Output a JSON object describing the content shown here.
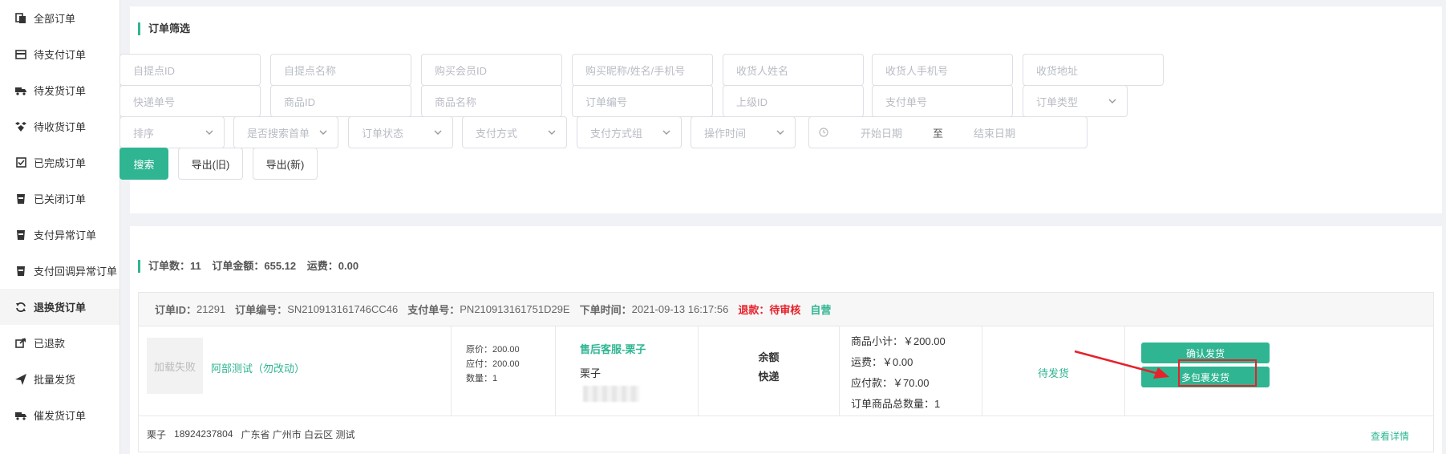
{
  "sidebar": {
    "items": [
      {
        "label": "全部订单",
        "icon": "copy-icon"
      },
      {
        "label": "待支付订单",
        "icon": "card-icon"
      },
      {
        "label": "待发货订单",
        "icon": "truck-icon"
      },
      {
        "label": "待收货订单",
        "icon": "boxes-icon"
      },
      {
        "label": "已完成订单",
        "icon": "check-square-icon"
      },
      {
        "label": "已关闭订单",
        "icon": "cup-icon"
      },
      {
        "label": "支付异常订单",
        "icon": "cup-icon"
      },
      {
        "label": "支付回调异常订单",
        "icon": "cup-icon"
      },
      {
        "label": "退换货订单",
        "icon": "refresh-icon",
        "active": true
      },
      {
        "label": "已退款",
        "icon": "share-icon"
      },
      {
        "label": "批量发货",
        "icon": "send-icon"
      },
      {
        "label": "催发货订单",
        "icon": "truck-icon"
      }
    ]
  },
  "filter": {
    "title": "订单筛选",
    "row1": [
      "自提点ID",
      "自提点名称",
      "购买会员ID",
      "购买昵称/姓名/手机号",
      "收货人姓名",
      "收货人手机号",
      "收货地址"
    ],
    "row2": [
      "快递单号",
      "商品ID",
      "商品名称",
      "订单编号",
      "上级ID",
      "支付单号"
    ],
    "order_type": "订单类型",
    "row3": [
      "排序",
      "是否搜索首单",
      "订单状态",
      "支付方式",
      "支付方式组",
      "操作时间"
    ],
    "date_start": "开始日期",
    "date_sep": "至",
    "date_end": "结束日期",
    "search_btn": "搜索",
    "export_old": "导出(旧)",
    "export_new": "导出(新)"
  },
  "summary": {
    "count": "订单数：11",
    "amount": "订单金额：655.12",
    "freight": "运费：0.00"
  },
  "order": {
    "id_label": "订单ID：",
    "id": "21291",
    "no_label": "订单编号：",
    "no": "SN210913161746CC46",
    "pay_no_label": "支付单号：",
    "pay_no": "PN210913161751D29E",
    "time_label": "下单时间：",
    "time": "2021-09-13 16:17:56",
    "refund": "退款：待审核",
    "self": "自营",
    "thumb_text": "加载失败",
    "product_name": "阿部测试（勿改动）",
    "orig_price": "原价：200.00",
    "payable": "应付：200.00",
    "qty": "数量：1",
    "cs_name": "售后客服-栗子",
    "cs_user": "栗子",
    "pay_method": "余额",
    "ship_method": "快递",
    "subtotal": "商品小计：￥200.00",
    "freight": "运费：￥0.00",
    "pay_amount": "应付款：￥70.00",
    "total_qty": "订单商品总数量：1",
    "status": "待发货",
    "btn_confirm": "确认发货",
    "btn_multi": "多包裹发货",
    "recv_name": "栗子",
    "recv_phone": "18924237804",
    "recv_addr": "广东省 广州市 白云区 测试",
    "detail": "查看详情"
  },
  "colors": {
    "accent": "#2fb592",
    "danger": "#e6212a"
  }
}
